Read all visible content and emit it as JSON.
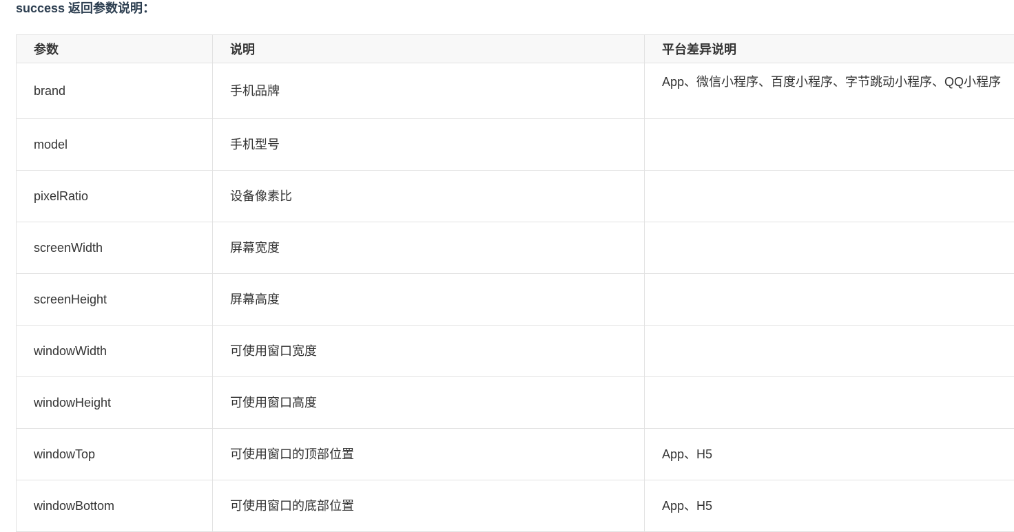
{
  "title": "success 返回参数说明：",
  "table": {
    "headers": [
      "参数",
      "说明",
      "平台差异说明"
    ],
    "rows": [
      {
        "param": "brand",
        "desc": "手机品牌",
        "platform": "App、微信小程序、百度小程序、字节跳动小程序、QQ小程序"
      },
      {
        "param": "model",
        "desc": "手机型号",
        "platform": ""
      },
      {
        "param": "pixelRatio",
        "desc": "设备像素比",
        "platform": ""
      },
      {
        "param": "screenWidth",
        "desc": "屏幕宽度",
        "platform": ""
      },
      {
        "param": "screenHeight",
        "desc": "屏幕高度",
        "platform": ""
      },
      {
        "param": "windowWidth",
        "desc": "可使用窗口宽度",
        "platform": ""
      },
      {
        "param": "windowHeight",
        "desc": "可使用窗口高度",
        "platform": ""
      },
      {
        "param": "windowTop",
        "desc": "可使用窗口的顶部位置",
        "platform": "App、H5"
      },
      {
        "param": "windowBottom",
        "desc": "可使用窗口的底部位置",
        "platform": "App、H5"
      }
    ]
  }
}
